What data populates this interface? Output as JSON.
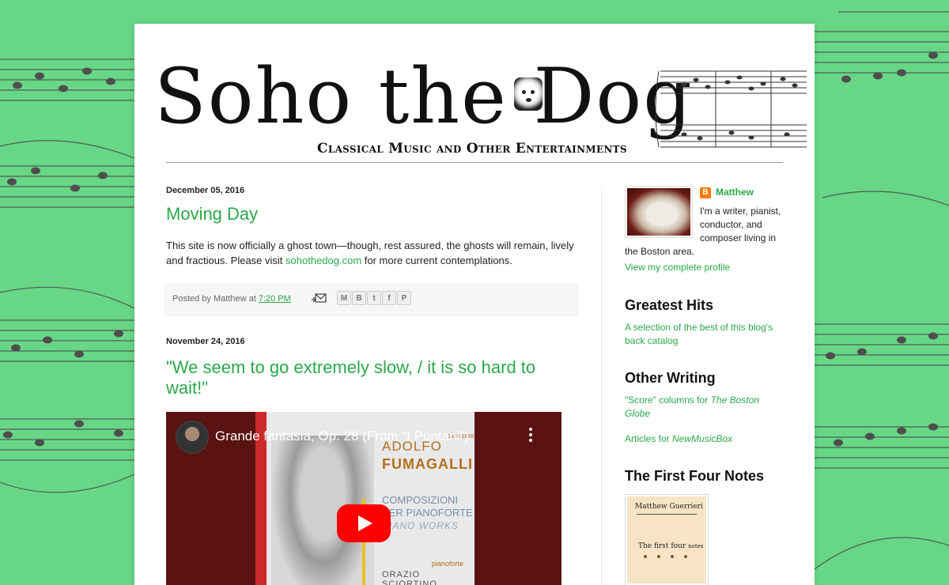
{
  "blog": {
    "title": "Soho the Dog",
    "subtitle": "Classical Music and Other Entertainments"
  },
  "posts": [
    {
      "date": "December 05, 2016",
      "title": "Moving Day",
      "body_before_link": "This site is now officially a ghost town—though, rest assured, the ghosts will remain, lively and fractious. Please visit ",
      "link_text": "sohothedog.com",
      "body_after_link": " for more current contemplations.",
      "footer": {
        "posted_by": "Posted by Matthew at ",
        "time": "7:20 PM"
      },
      "share_icons": [
        "email-icon",
        "blogger-icon",
        "twitter-icon",
        "facebook-icon",
        "pinterest-icon"
      ]
    },
    {
      "date": "November 24, 2016",
      "title": "\"We seem to go extremely slow, / it is so hard to wait!\"",
      "video": {
        "title": "Grande fantasia, Op. 28 (From \"I Puritani\")",
        "cover": {
          "composer_first": "ADOLFO",
          "composer_last": "FUMAGALLI",
          "years": "1828 1856",
          "line1": "COMPOSIZIONI",
          "line2": "PER PIANOFORTE",
          "line3": "PIANO WORKS",
          "performer_role": "pianoforte",
          "performer_name": "ORAZIO SCIORTINO"
        }
      }
    }
  ],
  "sidebar": {
    "profile": {
      "name": "Matthew",
      "bio": "I'm a writer, pianist, conductor, and composer living in the Boston area.",
      "bio_lines": [
        "I'm a writer, pianist,",
        "conductor, and",
        "composer living in",
        "the Boston area."
      ],
      "link": "View my complete profile"
    },
    "greatest_hits": {
      "title": "Greatest Hits",
      "link": "A selection of the best of this blog's back catalog"
    },
    "other_writing": {
      "title": "Other Writing",
      "score_prefix": "\"Score\" columns for ",
      "score_pub": "The Boston Globe",
      "articles_prefix": "Articles for ",
      "articles_pub": "NewMusicBox"
    },
    "first_four_notes": {
      "title": "The First Four Notes",
      "book_author": "Matthew Guerrieri",
      "book_title_a": "The first four",
      "book_title_b": "notes"
    }
  },
  "colors": {
    "background": "#67d785",
    "link": "#2aa84a",
    "text": "#222222"
  }
}
